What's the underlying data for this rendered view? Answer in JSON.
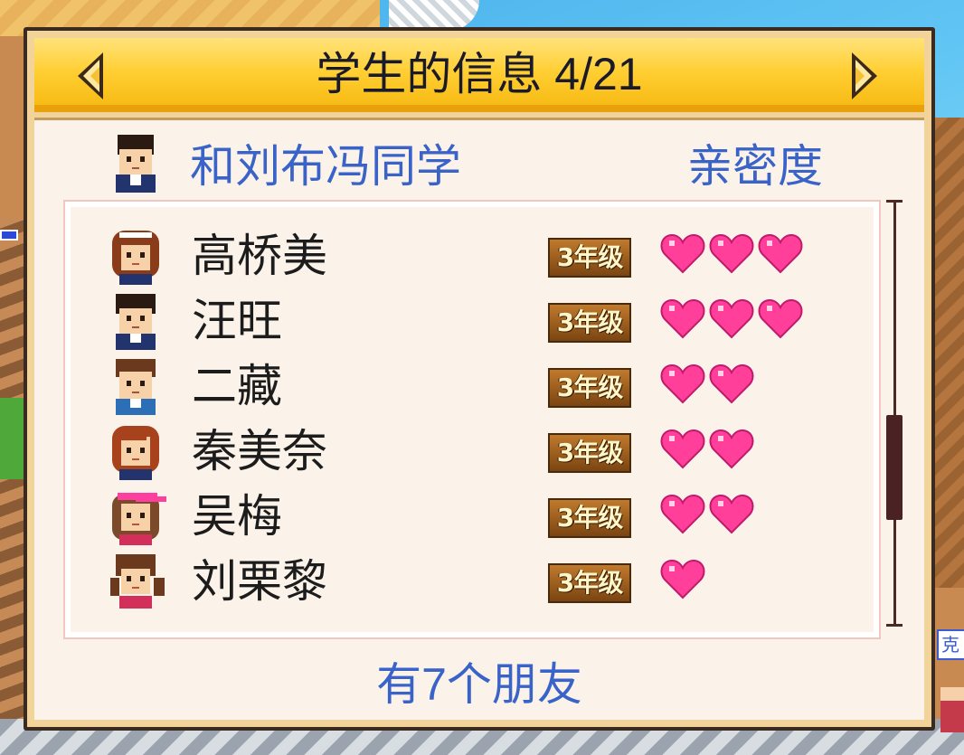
{
  "title": "学生的信息 4/21",
  "header": {
    "name": "和刘布冯同学",
    "affinity_label": "亲密度"
  },
  "friends": [
    {
      "name": "高桥美",
      "grade": "3年级",
      "hearts": 3,
      "avatar": "girl-brown-headband"
    },
    {
      "name": "汪旺",
      "grade": "3年级",
      "hearts": 3,
      "avatar": "boy-dark-hair"
    },
    {
      "name": "二藏",
      "grade": "3年级",
      "hearts": 2,
      "avatar": "boy-brown-hair"
    },
    {
      "name": "秦美奈",
      "grade": "3年级",
      "hearts": 2,
      "avatar": "girl-auburn-hair"
    },
    {
      "name": "吴梅",
      "grade": "3年级",
      "hearts": 2,
      "avatar": "girl-pink-visor"
    },
    {
      "name": "刘栗黎",
      "grade": "3年级",
      "hearts": 1,
      "avatar": "girl-pigtails"
    }
  ],
  "footer": "有7个朋友",
  "bg_sign_text": "克",
  "colors": {
    "accent_blue": "#3a63c9",
    "title_bar": "#ffcf33",
    "heart": "#ff3f9a",
    "grade_badge": "#9a5a1e"
  }
}
